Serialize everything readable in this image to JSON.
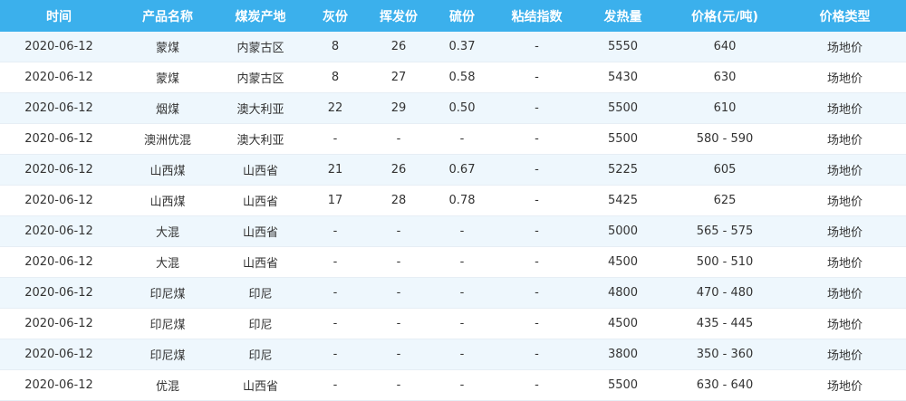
{
  "table": {
    "headers": [
      "时间",
      "产品名称",
      "煤炭产地",
      "灰份",
      "挥发份",
      "硫份",
      "粘结指数",
      "发热量",
      "价格(元/吨)",
      "价格类型"
    ],
    "rows": [
      [
        "2020-06-12",
        "蒙煤",
        "内蒙古区",
        "8",
        "26",
        "0.37",
        "-",
        "5550",
        "640",
        "场地价"
      ],
      [
        "2020-06-12",
        "蒙煤",
        "内蒙古区",
        "8",
        "27",
        "0.58",
        "-",
        "5430",
        "630",
        "场地价"
      ],
      [
        "2020-06-12",
        "烟煤",
        "澳大利亚",
        "22",
        "29",
        "0.50",
        "-",
        "5500",
        "610",
        "场地价"
      ],
      [
        "2020-06-12",
        "澳洲优混",
        "澳大利亚",
        "-",
        "-",
        "-",
        "-",
        "5500",
        "580 - 590",
        "场地价"
      ],
      [
        "2020-06-12",
        "山西煤",
        "山西省",
        "21",
        "26",
        "0.67",
        "-",
        "5225",
        "605",
        "场地价"
      ],
      [
        "2020-06-12",
        "山西煤",
        "山西省",
        "17",
        "28",
        "0.78",
        "-",
        "5425",
        "625",
        "场地价"
      ],
      [
        "2020-06-12",
        "大混",
        "山西省",
        "-",
        "-",
        "-",
        "-",
        "5000",
        "565 - 575",
        "场地价"
      ],
      [
        "2020-06-12",
        "大混",
        "山西省",
        "-",
        "-",
        "-",
        "-",
        "4500",
        "500 - 510",
        "场地价"
      ],
      [
        "2020-06-12",
        "印尼煤",
        "印尼",
        "-",
        "-",
        "-",
        "-",
        "4800",
        "470 - 480",
        "场地价"
      ],
      [
        "2020-06-12",
        "印尼煤",
        "印尼",
        "-",
        "-",
        "-",
        "-",
        "4500",
        "435 - 445",
        "场地价"
      ],
      [
        "2020-06-12",
        "印尼煤",
        "印尼",
        "-",
        "-",
        "-",
        "-",
        "3800",
        "350 - 360",
        "场地价"
      ],
      [
        "2020-06-12",
        "优混",
        "山西省",
        "-",
        "-",
        "-",
        "-",
        "5500",
        "630 - 640",
        "场地价"
      ]
    ]
  },
  "colors": {
    "header_bg": "#3bb0ec",
    "header_text": "#ffffff",
    "row_alt_bg": "#eef7fd",
    "row_bg": "#ffffff",
    "cell_text": "#333333"
  }
}
